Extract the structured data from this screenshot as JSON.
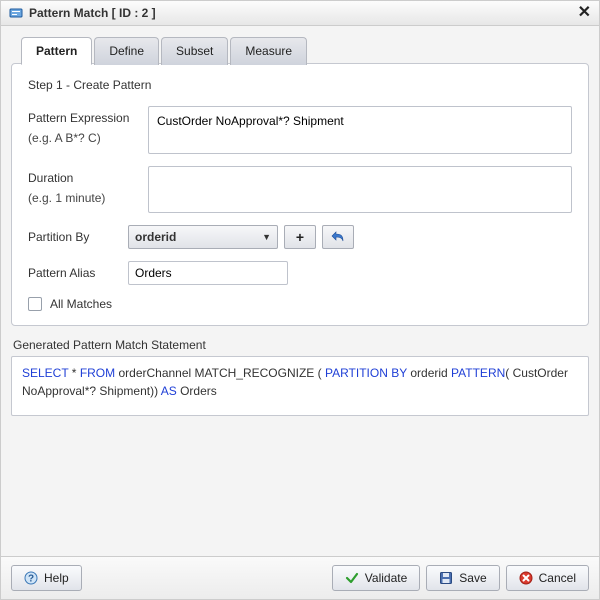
{
  "titlebar": {
    "title": "Pattern Match [ ID : 2 ]"
  },
  "tabs": [
    {
      "label": "Pattern"
    },
    {
      "label": "Define"
    },
    {
      "label": "Subset"
    },
    {
      "label": "Measure"
    }
  ],
  "form": {
    "step_title": "Step 1 - Create Pattern",
    "pattern_expression_label": "Pattern Expression",
    "pattern_expression_hint": "(e.g. A B*? C)",
    "pattern_expression_value": "CustOrder NoApproval*? Shipment",
    "duration_label": "Duration",
    "duration_hint": "(e.g. 1 minute)",
    "duration_value": "",
    "partition_by_label": "Partition By",
    "partition_by_value": "orderid",
    "add_btn_label": "+",
    "pattern_alias_label": "Pattern Alias",
    "pattern_alias_value": "Orders",
    "all_matches_label": "All Matches"
  },
  "generated": {
    "label": "Generated Pattern Match Statement",
    "sql": {
      "k_select": "SELECT",
      "t1": " * ",
      "k_from": "FROM",
      "t2": " orderChannel  MATCH_RECOGNIZE ( ",
      "k_partition": "PARTITION BY",
      "t3": " orderid ",
      "k_pattern": "PATTERN",
      "t4": "( CustOrder NoApproval*? Shipment)) ",
      "k_as": "AS",
      "t5": " Orders"
    }
  },
  "footer": {
    "help_label": "Help",
    "validate_label": "Validate",
    "save_label": "Save",
    "cancel_label": "Cancel"
  }
}
